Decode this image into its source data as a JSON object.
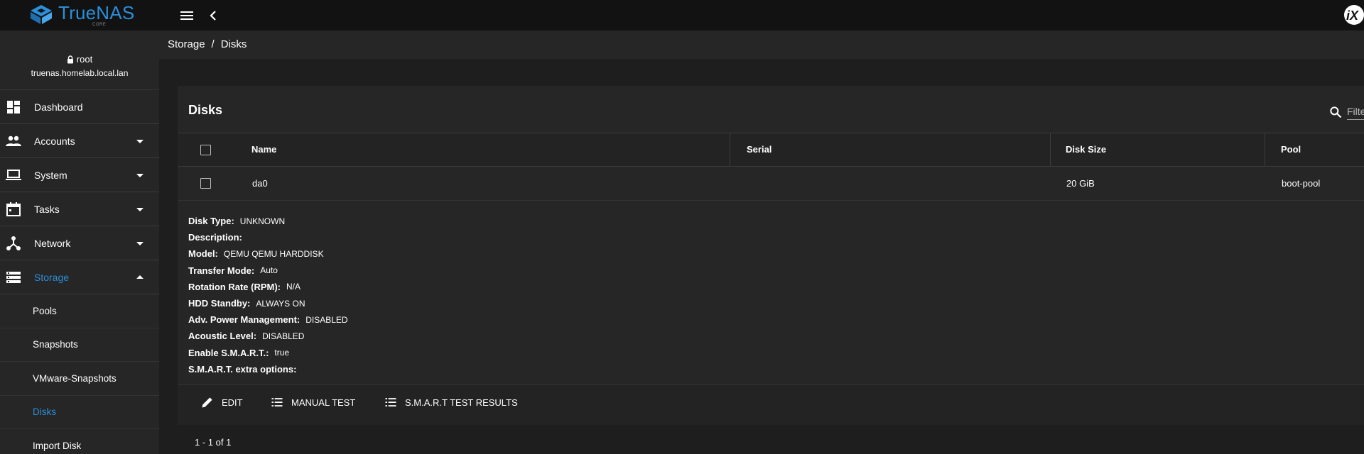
{
  "brand": {
    "name": "TrueNAS",
    "edition": "CORE",
    "colors": {
      "accent": "#2b8ed8",
      "topbar": "#121212",
      "panel": "#262626",
      "background": "#1e1e1e"
    }
  },
  "topbar": {
    "menu_icon": "menu-icon",
    "back_icon": "chevron-left-icon",
    "vendor_icon": "ix-systems-logo"
  },
  "user": {
    "name": "root",
    "hostname": "truenas.homelab.local.lan",
    "icon": "lock-icon"
  },
  "sidebar": {
    "items": [
      {
        "label": "Dashboard",
        "icon": "dashboard-icon"
      },
      {
        "label": "Accounts",
        "icon": "people-icon",
        "expandable": true
      },
      {
        "label": "System",
        "icon": "laptop-icon",
        "expandable": true
      },
      {
        "label": "Tasks",
        "icon": "calendar-icon",
        "expandable": true
      },
      {
        "label": "Network",
        "icon": "network-icon",
        "expandable": true
      },
      {
        "label": "Storage",
        "icon": "storage-icon",
        "expanded": true,
        "active": true
      }
    ],
    "storage_subitems": [
      {
        "label": "Pools"
      },
      {
        "label": "Snapshots"
      },
      {
        "label": "VMware-Snapshots"
      },
      {
        "label": "Disks",
        "active": true
      },
      {
        "label": "Import Disk"
      }
    ]
  },
  "breadcrumb": {
    "parent": "Storage",
    "separator": "/",
    "current": "Disks"
  },
  "card": {
    "title": "Disks",
    "filter_placeholder": "Filter",
    "columns": [
      "Name",
      "Serial",
      "Disk Size",
      "Pool"
    ],
    "rows": [
      {
        "name": "da0",
        "serial": "",
        "disk_size": "20 GiB",
        "pool": "boot-pool"
      }
    ],
    "details": [
      {
        "label": "Disk Type:",
        "value": "UNKNOWN"
      },
      {
        "label": "Description:",
        "value": ""
      },
      {
        "label": "Model:",
        "value": "QEMU QEMU HARDDISK"
      },
      {
        "label": "Transfer Mode:",
        "value": "Auto"
      },
      {
        "label": "Rotation Rate (RPM):",
        "value": "N/A"
      },
      {
        "label": "HDD Standby:",
        "value": "ALWAYS ON"
      },
      {
        "label": "Adv. Power Management:",
        "value": "DISABLED"
      },
      {
        "label": "Acoustic Level:",
        "value": "DISABLED"
      },
      {
        "label": "Enable S.M.A.R.T.:",
        "value": "true"
      },
      {
        "label": "S.M.A.R.T. extra options:",
        "value": ""
      }
    ],
    "actions": [
      {
        "label": "EDIT",
        "icon": "pencil-icon"
      },
      {
        "label": "MANUAL TEST",
        "icon": "list-icon"
      },
      {
        "label": "S.M.A.R.T TEST RESULTS",
        "icon": "list-icon"
      }
    ],
    "pagination": "1 - 1 of 1"
  }
}
